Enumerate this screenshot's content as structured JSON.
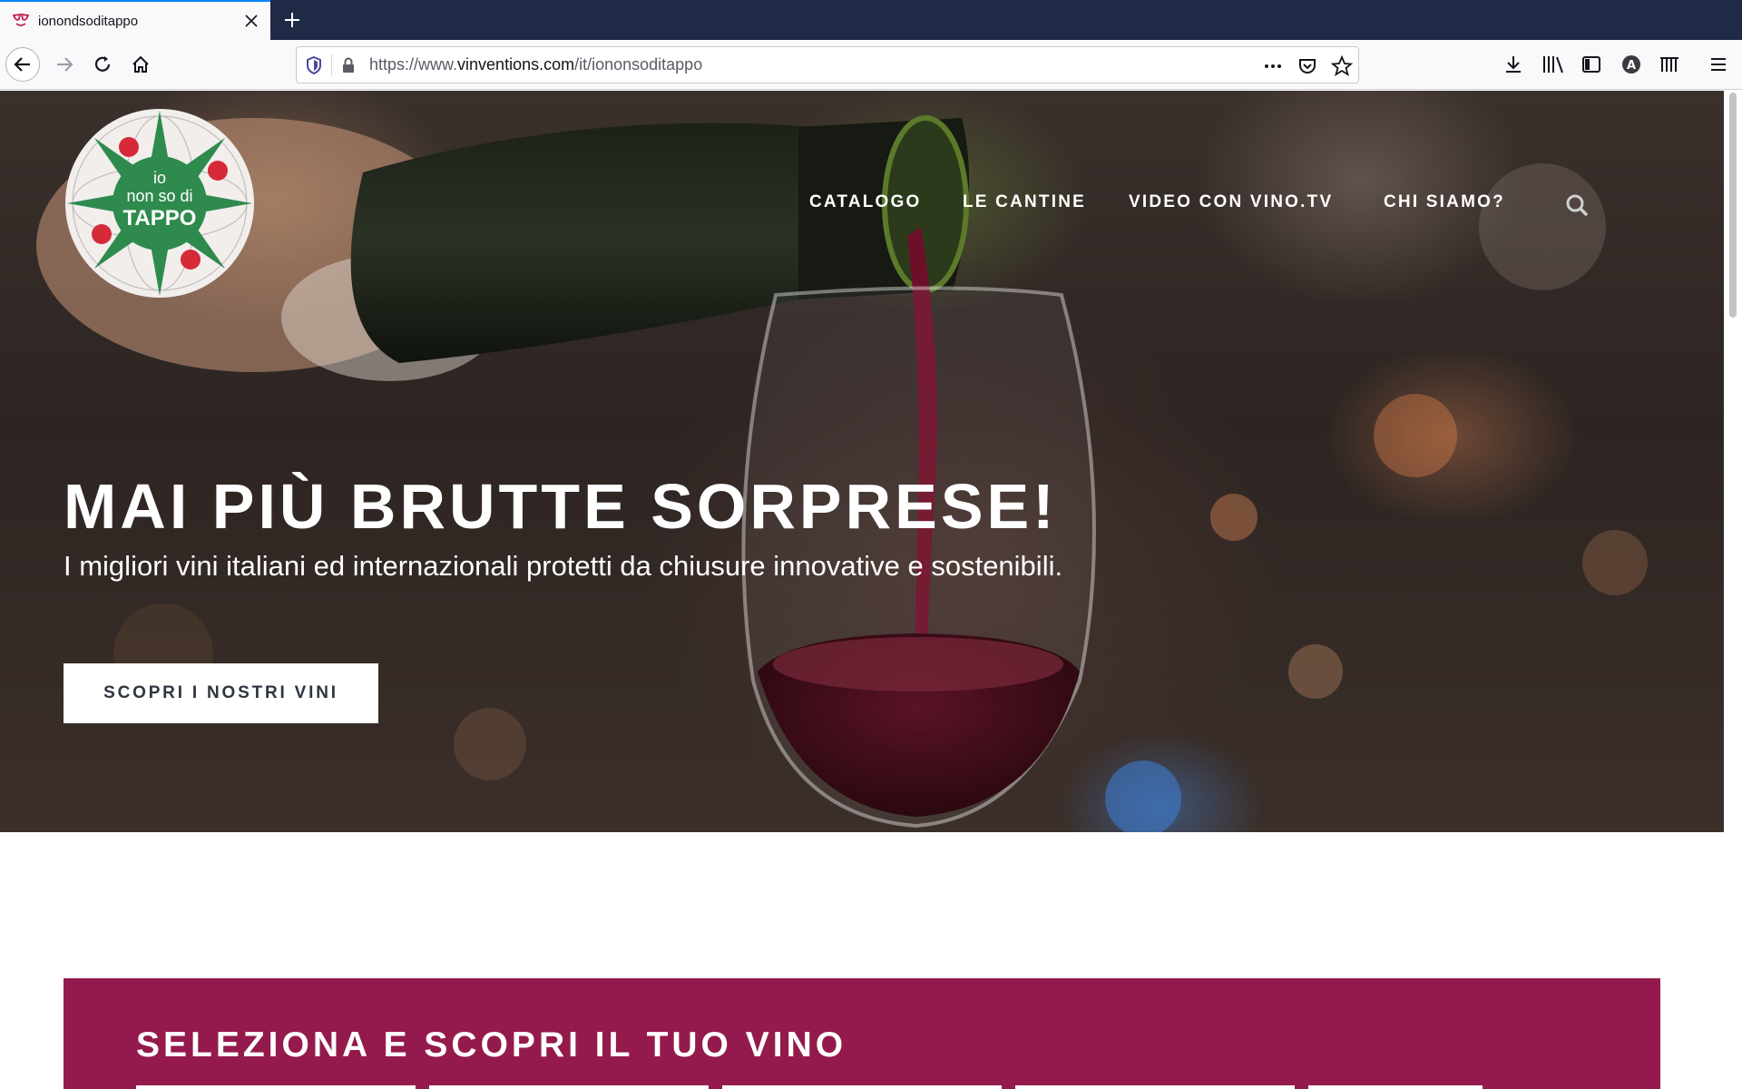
{
  "browser": {
    "tab": {
      "title": "ionondsoditappo",
      "favicon": "wine-glasses-icon",
      "close_icon": "close-icon"
    },
    "new_tab_icon": "plus-icon",
    "nav": {
      "back_icon": "arrow-left-icon",
      "forward_icon": "arrow-right-icon",
      "reload_icon": "reload-icon",
      "home_icon": "home-icon"
    },
    "urlbar": {
      "prefix": "https://www.",
      "host": "vinventions.com",
      "path": "/it/iononsoditappo",
      "icons": [
        "shield-icon",
        "lock-icon",
        "more-icon",
        "pocket-icon",
        "star-icon"
      ]
    },
    "toolbar_icons": [
      "download-icon",
      "library-icon",
      "sidebar-icon",
      "account-icon",
      "extension-icon",
      "menu-icon"
    ]
  },
  "site": {
    "logo": {
      "line1": "io",
      "line2": "non so di",
      "line3": "TAPPO"
    },
    "nav": {
      "items": [
        "CATALOGO",
        "LE CANTINE",
        "VIDEO CON VINO.TV",
        "CHI SIAMO?"
      ],
      "search_icon": "search-icon"
    },
    "hero": {
      "title": "MAI PIÙ BRUTTE SORPRESE!",
      "subtitle": "I migliori vini italiani ed internazionali protetti da chiusure innovative e sostenibili.",
      "cta": "SCOPRI I NOSTRI VINI"
    },
    "selector": {
      "title": "SELEZIONA E SCOPRI IL TUO VINO"
    }
  },
  "colors": {
    "accent": "#941a4d",
    "tab_indicator": "#0a84ff",
    "tabstrip": "#1f2b46"
  }
}
